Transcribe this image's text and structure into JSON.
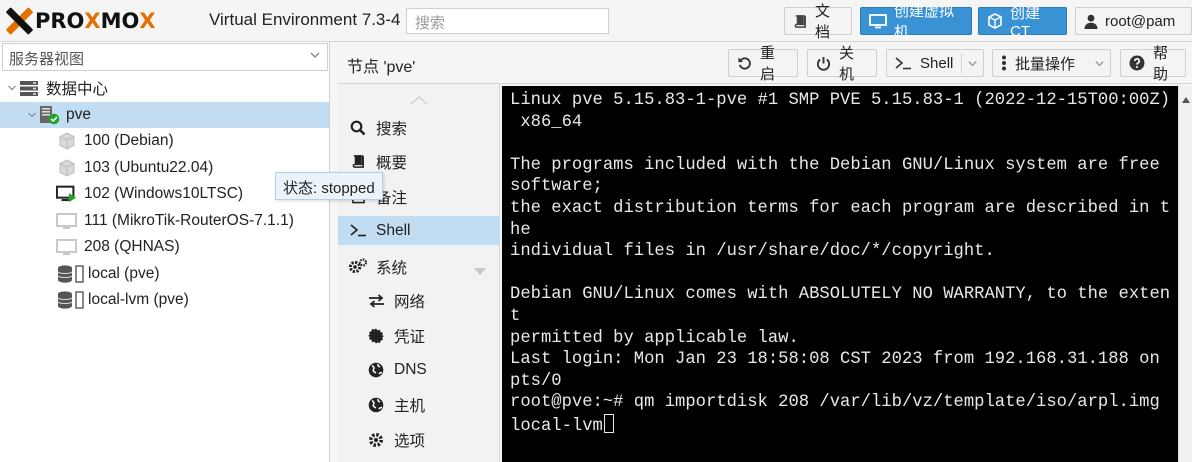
{
  "header": {
    "logo_prefix": "PRO",
    "logo_x": "X",
    "logo_mid": "MO",
    "logo_x2": "X",
    "version": "Virtual Environment 7.3-4",
    "search_placeholder": "搜索",
    "btn_docs": "文档",
    "btn_create_vm": "创建虚拟机",
    "btn_create_ct": "创建CT",
    "btn_user": "root@pam",
    "accent": "#3892d3",
    "brand_orange": "#e57000"
  },
  "sidebar": {
    "view_selector": "服务器视图",
    "tree": {
      "datacenter": "数据中心",
      "node": "pve",
      "guests": [
        {
          "label": "100 (Debian)",
          "type": "ct"
        },
        {
          "label": "103 (Ubuntu22.04)",
          "type": "ct"
        },
        {
          "label": "102 (Windows10LTSC)",
          "type": "vm-running"
        },
        {
          "label": "111 (MikroTik-RouterOS-7.1.1)",
          "type": "vm"
        },
        {
          "label": "208 (QHNAS)",
          "type": "vm"
        }
      ],
      "storages": [
        {
          "label": "local (pve)"
        },
        {
          "label": "local-lvm (pve)"
        }
      ]
    },
    "tooltip": "状态: stopped"
  },
  "content": {
    "title": "节点 'pve'",
    "toolbar": {
      "reboot": "重启",
      "shutdown": "关机",
      "shell": "Shell",
      "bulk": "批量操作",
      "help": "帮助"
    },
    "nav": {
      "search": "搜索",
      "summary": "概要",
      "notes": "备注",
      "shell": "Shell",
      "system": "系统",
      "network": "网络",
      "certificates": "凭证",
      "dns": "DNS",
      "hosts": "主机",
      "options": "选项"
    },
    "terminal_lines": [
      "Linux pve 5.15.83-1-pve #1 SMP PVE 5.15.83-1 (2022-12-15T00:00Z)",
      " x86_64",
      "",
      "The programs included with the Debian GNU/Linux system are free",
      "software;",
      "the exact distribution terms for each program are described in t",
      "he",
      "individual files in /usr/share/doc/*/copyright.",
      "",
      "Debian GNU/Linux comes with ABSOLUTELY NO WARRANTY, to the exten",
      "t",
      "permitted by applicable law.",
      "Last login: Mon Jan 23 18:58:08 CST 2023 from 192.168.31.188 on",
      "pts/0",
      "root@pve:~# qm importdisk 208 /var/lib/vz/template/iso/arpl.img",
      "local-lvm"
    ]
  }
}
